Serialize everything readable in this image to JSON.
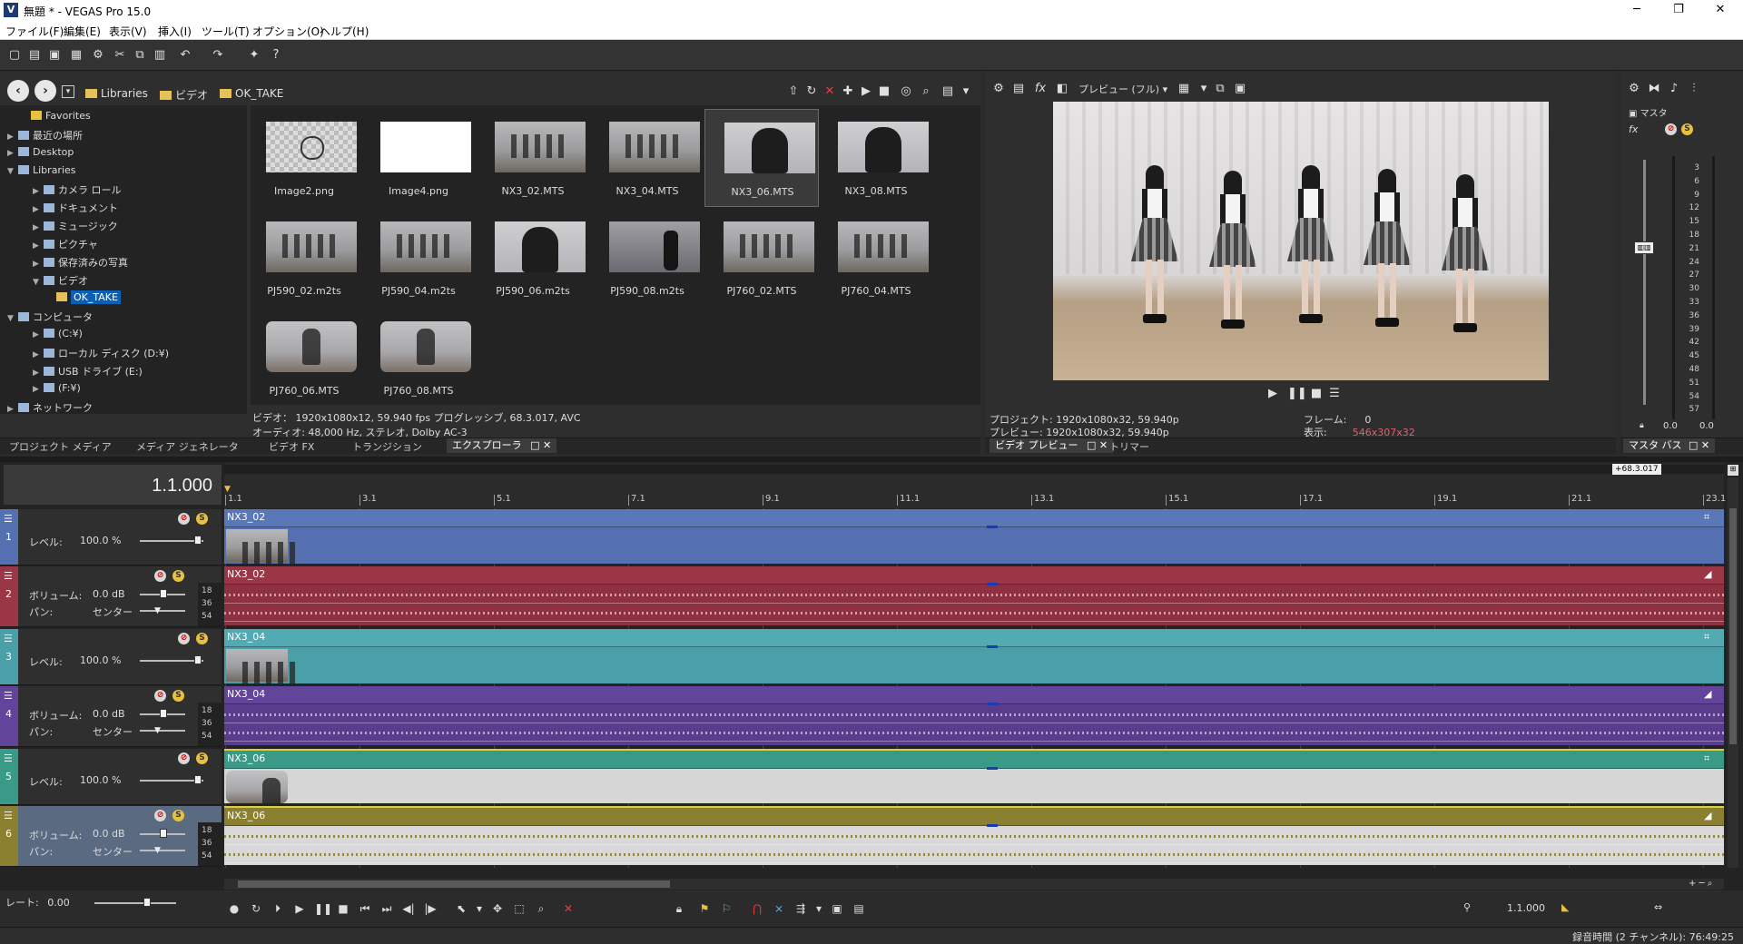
{
  "window": {
    "title": "無題 * - VEGAS Pro 15.0",
    "logo": "V",
    "controls": {
      "minimize": "─",
      "maximize": "❐",
      "close": "✕"
    }
  },
  "menu": [
    "ファイル(F)",
    "編集(E)",
    "表示(V)",
    "挿入(I)",
    "ツール(T)",
    "オプション(O)",
    "ヘルプ(H)"
  ],
  "explorer": {
    "breadcrumb": [
      "Libraries",
      "ビデオ",
      "OK_TAKE"
    ],
    "tree": [
      {
        "label": "Favorites",
        "indent": 1
      },
      {
        "label": "最近の場所",
        "indent": 0
      },
      {
        "label": "Desktop",
        "indent": 0
      },
      {
        "label": "Libraries",
        "indent": 0
      },
      {
        "label": "カメラ ロール",
        "indent": 2
      },
      {
        "label": "ドキュメント",
        "indent": 2
      },
      {
        "label": "ミュージック",
        "indent": 2
      },
      {
        "label": "ピクチャ",
        "indent": 2
      },
      {
        "label": "保存済みの写真",
        "indent": 2
      },
      {
        "label": "ビデオ",
        "indent": 2
      },
      {
        "label": "OK_TAKE",
        "indent": 3
      },
      {
        "label": "コンピュータ",
        "indent": 0
      },
      {
        "label": "(C:¥)",
        "indent": 2
      },
      {
        "label": "ローカル ディスク (D:¥)",
        "indent": 2
      },
      {
        "label": "USB ドライブ (E:)",
        "indent": 2
      },
      {
        "label": "(F:¥)",
        "indent": 2
      },
      {
        "label": "ネットワーク",
        "indent": 0
      }
    ],
    "files": [
      {
        "name": "Image2.png",
        "kind": "checker"
      },
      {
        "name": "Image4.png",
        "kind": "white"
      },
      {
        "name": "NX3_02.MTS",
        "kind": "group"
      },
      {
        "name": "NX3_04.MTS",
        "kind": "group"
      },
      {
        "name": "NX3_06.MTS",
        "kind": "closeup"
      },
      {
        "name": "NX3_08.MTS",
        "kind": "closeup"
      },
      {
        "name": "PJ590_02.m2ts",
        "kind": "group"
      },
      {
        "name": "PJ590_04.m2ts",
        "kind": "group"
      },
      {
        "name": "PJ590_06.m2ts",
        "kind": "closeup"
      },
      {
        "name": "PJ590_08.m2ts",
        "kind": "dark"
      },
      {
        "name": "PJ760_02.MTS",
        "kind": "group"
      },
      {
        "name": "PJ760_04.MTS",
        "kind": "group"
      },
      {
        "name": "PJ760_06.MTS",
        "kind": "solo"
      },
      {
        "name": "PJ760_08.MTS",
        "kind": "solo"
      }
    ],
    "info_video": "ビデオ： 1920x1080x12, 59.940 fps プログレッシブ, 68.3.017, AVC",
    "info_audio": "オーディオ: 48,000 Hz, ステレオ, Dolby AC-3",
    "tabs": [
      "プロジェクト メディア",
      "メディア ジェネレータ",
      "ビデオ FX",
      "トランジション",
      "エクスプローラ"
    ]
  },
  "preview": {
    "toolbar_label": "プレビュー (フル)",
    "project_label": "プロジェクト:",
    "project_value": "1920x1080x32, 59.940p",
    "preview_label": "プレビュー:",
    "preview_value": "1920x1080x32, 59.940p",
    "frame_label": "フレーム:",
    "frame_value": "0",
    "display_label": "表示:",
    "display_value": "546x307x32",
    "tabs": [
      "ビデオ プレビュー",
      "トリマー"
    ]
  },
  "master": {
    "label": "マスタ",
    "scale": [
      "3",
      "6",
      "9",
      "12",
      "15",
      "18",
      "21",
      "24",
      "27",
      "30",
      "33",
      "36",
      "39",
      "42",
      "45",
      "48",
      "51",
      "54",
      "57"
    ],
    "readout_left": "0.0",
    "readout_right": "0.0",
    "tab": "マスタ バス"
  },
  "timeline": {
    "cursor_time": "1.1.000",
    "marker_label": "+68.3.017",
    "ruler": [
      "1.1",
      "3.1",
      "5.1",
      "7.1",
      "9.1",
      "11.1",
      "13.1",
      "15.1",
      "17.1",
      "19.1",
      "21.1",
      "23.1"
    ],
    "meter_marks": [
      "18",
      "36",
      "54"
    ],
    "tracks": [
      {
        "num": "1",
        "type": "video",
        "param_label": "レベル:",
        "param_value": "100.0 %",
        "clip": "NX3_02",
        "color": "#5470b0",
        "hdr": "#5a78b8"
      },
      {
        "num": "2",
        "type": "audio",
        "param_label": "ボリューム:",
        "param_value": "0.0 dB",
        "pan_label": "パン:",
        "pan_value": "センター",
        "clip": "NX3_02",
        "color": "#8e3040",
        "hdr": "#9a3646",
        "wave": "#e0a8b0"
      },
      {
        "num": "3",
        "type": "video",
        "param_label": "レベル:",
        "param_value": "100.0 %",
        "clip": "NX3_04",
        "color": "#4aa0a8",
        "hdr": "#52aab2"
      },
      {
        "num": "4",
        "type": "audio",
        "param_label": "ボリューム:",
        "param_value": "0.0 dB",
        "pan_label": "パン:",
        "pan_value": "センター",
        "clip": "NX3_04",
        "color": "#5a3c8c",
        "hdr": "#62449a",
        "wave": "#c0aee0"
      },
      {
        "num": "5",
        "type": "video",
        "param_label": "レベル:",
        "param_value": "100.0 %",
        "clip": "NX3_06",
        "color": "#d6d6d6",
        "hdr": "#3a9a88"
      },
      {
        "num": "6",
        "type": "audio",
        "param_label": "ボリューム:",
        "param_value": "0.0 dB",
        "pan_label": "パン:",
        "pan_value": "センター",
        "clip": "NX3_06",
        "color": "#d8d8d8",
        "hdr": "#8a8030",
        "wave": "#8a8030"
      }
    ],
    "rate_label": "レート:",
    "rate_value": "0.00",
    "transport_time": "1.1.000",
    "status": "録音時間 (2 チャンネル): 76:49:25"
  }
}
